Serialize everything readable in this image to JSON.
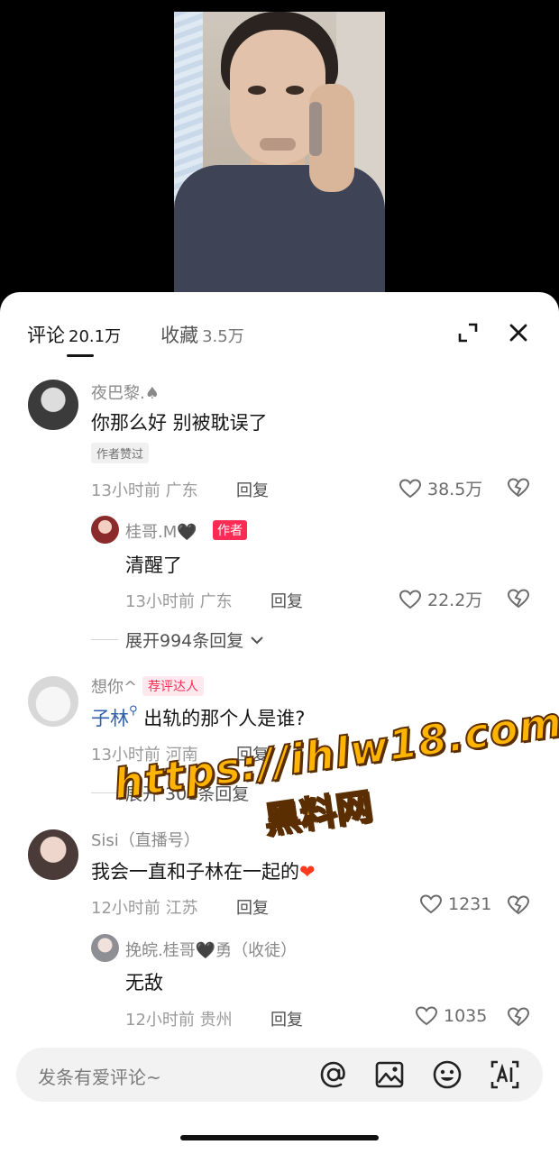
{
  "tabs": [
    {
      "label": "评论",
      "count": "20.1万",
      "active": true
    },
    {
      "label": "收藏",
      "count": "3.5万",
      "active": false
    }
  ],
  "header_icons": [
    "expand-icon",
    "close-icon"
  ],
  "comments": [
    {
      "username": "夜巴黎.♠",
      "text": "你那么好 别被耽误了",
      "badge": "作者赞过",
      "time": "13小时前",
      "location": "广东",
      "reply_label": "回复",
      "likes": "38.5万",
      "replies": [
        {
          "username": "桂哥.M🖤",
          "badge": "作者",
          "text": "清醒了",
          "time": "13小时前",
          "location": "广东",
          "reply_label": "回复",
          "likes": "22.2万"
        }
      ],
      "expand_label": "展开994条回复"
    },
    {
      "username": "想你^",
      "badge": "荐评达人",
      "mention": "子林",
      "text": "出轨的那个人是谁?",
      "time": "13小时前",
      "location": "河南",
      "reply_label": "回复",
      "likes": "",
      "expand_label": "展开 301条回复"
    },
    {
      "username": "Sisi（直播号）",
      "text": "我会一直和子林在一起的",
      "emoji": "❤",
      "time": "12小时前",
      "location": "江苏",
      "reply_label": "回复",
      "likes": "1231",
      "replies": [
        {
          "username": "挽皖.桂哥🖤勇（收徒）",
          "text": "无敌",
          "time": "12小时前",
          "location": "贵州",
          "reply_label": "回复",
          "likes": "1035"
        }
      ]
    }
  ],
  "watermark": {
    "line1": "https://ihlw18.com",
    "line2": "黑料网"
  },
  "input": {
    "placeholder": "发条有爱评论~"
  },
  "input_icons": [
    "at-icon",
    "image-icon",
    "emoji-icon",
    "ai-icon"
  ]
}
